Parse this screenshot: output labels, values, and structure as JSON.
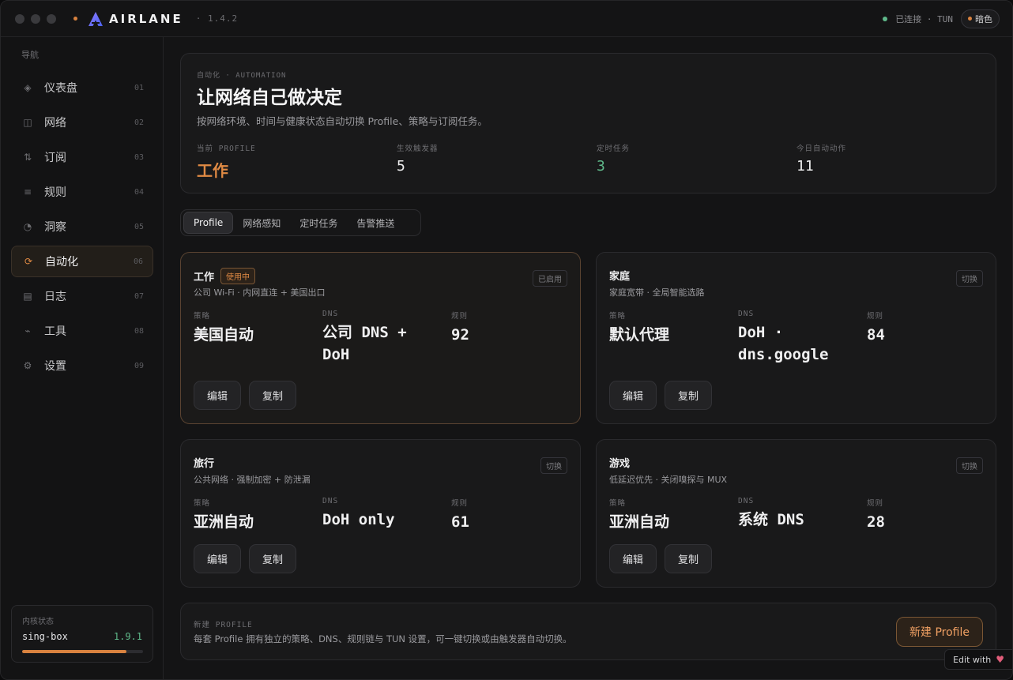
{
  "app": {
    "brand": "AIRLANE",
    "version": "· 1.4.2",
    "status": "已连接 · TUN",
    "theme_label": "暗色"
  },
  "sidebar": {
    "heading": "导航",
    "items": [
      {
        "icon": "dashboard-icon",
        "glyph": "◈",
        "label": "仪表盘",
        "num": "01"
      },
      {
        "icon": "network-icon",
        "glyph": "◫",
        "label": "网络",
        "num": "02"
      },
      {
        "icon": "subscription-icon",
        "glyph": "⇅",
        "label": "订阅",
        "num": "03"
      },
      {
        "icon": "rules-icon",
        "glyph": "≡",
        "label": "规则",
        "num": "04"
      },
      {
        "icon": "insight-icon",
        "glyph": "◔",
        "label": "洞察",
        "num": "05"
      },
      {
        "icon": "automation-icon",
        "glyph": "⟳",
        "label": "自动化",
        "num": "06"
      },
      {
        "icon": "log-icon",
        "glyph": "▤",
        "label": "日志",
        "num": "07"
      },
      {
        "icon": "tools-icon",
        "glyph": "⌁",
        "label": "工具",
        "num": "08"
      },
      {
        "icon": "settings-icon",
        "glyph": "⚙",
        "label": "设置",
        "num": "09"
      }
    ],
    "active_index": 5,
    "kernel": {
      "heading": "内核状态",
      "name": "sing-box",
      "version": "1.9.1",
      "progress": 0.86
    }
  },
  "hero": {
    "eyebrow": "自动化 · AUTOMATION",
    "title": "让网络自己做决定",
    "subtitle": "按网络环境、时间与健康状态自动切换 Profile、策略与订阅任务。",
    "stats": [
      {
        "label": "当前 PROFILE",
        "value": "工作"
      },
      {
        "label": "生效触发器",
        "value": "5"
      },
      {
        "label": "定时任务",
        "value": "3"
      },
      {
        "label": "今日自动动作",
        "value": "11"
      }
    ]
  },
  "tabs": [
    "Profile",
    "网络感知",
    "定时任务",
    "告警推送"
  ],
  "labels": {
    "strategy": "策略",
    "dns": "DNS",
    "rules": "规则",
    "edit": "编辑",
    "copy": "复制"
  },
  "profiles": [
    {
      "name": "工作",
      "badge": "使用中",
      "tag": "已启用",
      "desc": "公司 Wi-Fi · 内网直连 + 美国出口",
      "strategy": "美国自动",
      "dns": "公司 DNS + DoH",
      "rules": "92"
    },
    {
      "name": "家庭",
      "tag": "切换",
      "desc": "家庭宽带 · 全局智能选路",
      "strategy": "默认代理",
      "dns": "DoH · dns.google",
      "rules": "84"
    },
    {
      "name": "旅行",
      "tag": "切换",
      "desc": "公共网络 · 强制加密 + 防泄漏",
      "strategy": "亚洲自动",
      "dns": "DoH only",
      "rules": "61"
    },
    {
      "name": "游戏",
      "tag": "切换",
      "desc": "低延迟优先 · 关闭嗅探与 MUX",
      "strategy": "亚洲自动",
      "dns": "系统 DNS",
      "rules": "28"
    }
  ],
  "new_profile": {
    "eyebrow": "新建 PROFILE",
    "desc": "每套 Profile 拥有独立的策略、DNS、规则链与 TUN 设置，可一键切换或由触发器自动切换。",
    "button": "新建 Profile"
  },
  "edit_with": "Edit with"
}
